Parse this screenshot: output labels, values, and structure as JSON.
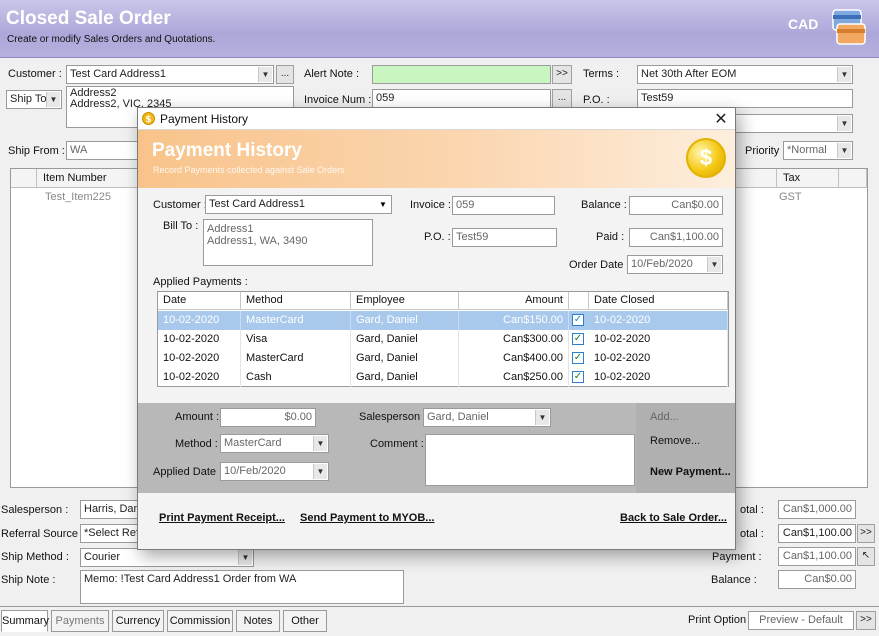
{
  "header": {
    "title": "Closed Sale Order",
    "subtitle": "Create or modify Sales Orders and Quotations.",
    "currency": "CAD",
    "icon": "cards-icon"
  },
  "order": {
    "customer_label": "Customer :",
    "customer_value": "Test Card Address1",
    "ship_to_option": "Ship To",
    "ship_to_line1": "Address2",
    "ship_to_line2": "Address2, VIC, 2345",
    "alert_note_label": "Alert Note :",
    "alert_note_value": "",
    "invoice_num_label": "Invoice Num :",
    "invoice_num_value": "059",
    "terms_label": "Terms :",
    "terms_value": "Net 30th After EOM",
    "po_label": "P.O. :",
    "po_value": "Test59",
    "ship_from_label": "Ship From :",
    "ship_from_value": "WA",
    "priority_label": "Priority :",
    "priority_value": "*Normal",
    "browse_label": "...",
    "more_label": ">>"
  },
  "items_table": {
    "columns": [
      "Item Number",
      "Tax"
    ],
    "rows": [
      {
        "item_number": "Test_Item225",
        "tax": "GST"
      }
    ]
  },
  "footer_left": {
    "salesperson_label": "Salesperson :",
    "salesperson_value": "Harris, Damc",
    "referral_label": "Referral Source :",
    "referral_value": "*Select Refe",
    "ship_method_label": "Ship Method :",
    "ship_method_value": "Courier",
    "ship_note_label": "Ship Note :",
    "ship_note_value": "Memo: !Test Card Address1 Order from WA"
  },
  "footer_right": {
    "total_label": "otal :",
    "total_value": "Can$1,000.00",
    "total2_label": "otal :",
    "total2_value": "Can$1,100.00",
    "payment_label": "Payment :",
    "payment_value": "Can$1,100.00",
    "balance_label": "Balance :",
    "balance_value": "Can$0.00"
  },
  "tabs": [
    "Summary",
    "Payments",
    "Currency",
    "Commission",
    "Notes",
    "Other"
  ],
  "print_option": {
    "label": "Print Option :",
    "value": "Preview - Default"
  },
  "dialog": {
    "window_title": "Payment History",
    "close_glyph": "✕",
    "banner_title": "Payment History",
    "banner_subtitle": "Record Payments collected against Sale Orders",
    "coin_icon": "dollar-coin-icon",
    "customer_label": "Customer :",
    "customer_value": "Test Card Address1",
    "invoice_label": "Invoice :",
    "invoice_value": "059",
    "balance_label": "Balance :",
    "balance_value": "Can$0.00",
    "bill_to_label": "Bill To :",
    "bill_to_line1": "Address1",
    "bill_to_line2": "Address1, WA, 3490",
    "po_label": "P.O. :",
    "po_value": "Test59",
    "paid_label": "Paid :",
    "paid_value": "Can$1,100.00",
    "order_date_label": "Order Date :",
    "order_date_value": "10/Feb/2020",
    "applied_payments_label": "Applied Payments :",
    "columns": [
      "Date",
      "Method",
      "Employee",
      "Amount",
      "",
      "Date Closed"
    ],
    "payments": [
      {
        "date": "10-02-2020",
        "method": "MasterCard",
        "employee": "Gard, Daniel",
        "amount": "Can$150.00",
        "checked": "✓",
        "date_closed": "10-02-2020"
      },
      {
        "date": "10-02-2020",
        "method": "Visa",
        "employee": "Gard, Daniel",
        "amount": "Can$300.00",
        "checked": "✓",
        "date_closed": "10-02-2020"
      },
      {
        "date": "10-02-2020",
        "method": "MasterCard",
        "employee": "Gard, Daniel",
        "amount": "Can$400.00",
        "checked": "✓",
        "date_closed": "10-02-2020"
      },
      {
        "date": "10-02-2020",
        "method": "Cash",
        "employee": "Gard, Daniel",
        "amount": "Can$250.00",
        "checked": "✓",
        "date_closed": "10-02-2020"
      }
    ],
    "amount_label": "Amount :",
    "amount_value": "$0.00",
    "salesperson_label": "Salesperson :",
    "salesperson_value": "Gard, Daniel",
    "method_label": "Method :",
    "method_value": "MasterCard",
    "comment_label": "Comment :",
    "comment_value": "",
    "applied_date_label": "Applied Date :",
    "applied_date_value": "10/Feb/2020",
    "add_label": "Add...",
    "remove_label": "Remove...",
    "new_payment_label": "New Payment...",
    "print_receipt_label": "Print Payment Receipt...",
    "send_myob_label": "Send Payment to MYOB...",
    "back_label": "Back to Sale Order..."
  }
}
